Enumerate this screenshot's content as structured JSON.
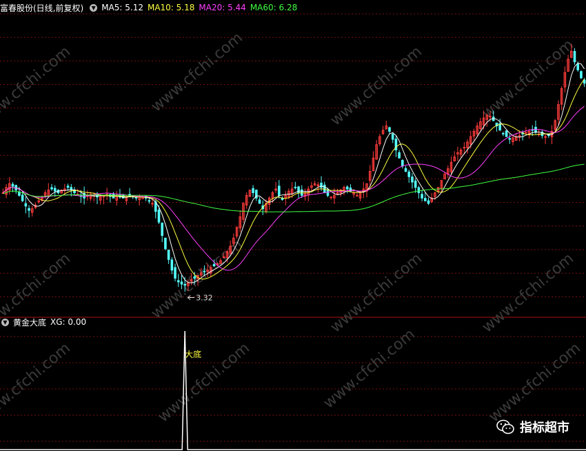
{
  "main_header": {
    "stock": "富春股份(日线,前复权)",
    "ma5": "MA5: 5.12",
    "ma10": "MA10: 5.18",
    "ma20": "MA20: 5.44",
    "ma60": "MA60: 6.28"
  },
  "sub_header": {
    "indicator": "黄金大底",
    "xg": "XG: 0.00"
  },
  "colors": {
    "up": "#ff3c3c",
    "down": "#54ffff",
    "ma5": "#ffffff",
    "ma10": "#ffff40",
    "ma20": "#ff40ff",
    "ma60": "#40ff40",
    "grid": "#7a1010"
  },
  "brand": "指标超市",
  "watermark": "www.cfchi.com",
  "chart_data": [
    {
      "type": "candlestick",
      "title": "富春股份(日线,前复权)",
      "ylim": [
        2.9,
        8.4
      ],
      "grid": true,
      "low_marker": {
        "label": "3.32",
        "value": 3.32
      },
      "closes": [
        5.05,
        5.15,
        5.22,
        5.17,
        5.1,
        5.0,
        4.9,
        4.8,
        4.72,
        4.75,
        4.82,
        4.9,
        4.95,
        5.05,
        5.1,
        5.12,
        5.08,
        5.05,
        5.1,
        5.12,
        5.15,
        5.1,
        5.05,
        5.02,
        4.98,
        4.95,
        5.0,
        5.02,
        5.0,
        4.97,
        4.98,
        5.0,
        5.02,
        4.98,
        4.95,
        4.98,
        4.97,
        4.95,
        4.98,
        4.99,
        4.97,
        4.95,
        4.98,
        4.97,
        4.95,
        4.9,
        4.85,
        4.7,
        4.5,
        4.25,
        4.0,
        3.8,
        3.6,
        3.45,
        3.38,
        3.34,
        3.32,
        3.36,
        3.42,
        3.45,
        3.5,
        3.55,
        3.58,
        3.6,
        3.65,
        3.68,
        3.72,
        3.78,
        3.85,
        3.95,
        4.05,
        4.2,
        4.4,
        4.6,
        4.85,
        5.0,
        5.1,
        5.05,
        4.95,
        4.85,
        4.75,
        4.85,
        4.95,
        5.05,
        5.12,
        5.0,
        4.92,
        5.0,
        5.08,
        5.12,
        5.15,
        5.05,
        5.0,
        5.05,
        5.12,
        5.18,
        5.22,
        5.2,
        5.15,
        5.05,
        5.0,
        4.97,
        5.0,
        5.05,
        5.1,
        5.15,
        5.12,
        5.08,
        5.05,
        5.0,
        5.05,
        5.12,
        5.22,
        5.45,
        5.7,
        5.95,
        6.1,
        6.22,
        6.3,
        6.2,
        6.05,
        5.85,
        5.7,
        5.55,
        5.45,
        5.35,
        5.25,
        5.15,
        5.05,
        4.95,
        4.9,
        4.85,
        4.95,
        5.05,
        5.15,
        5.28,
        5.4,
        5.5,
        5.62,
        5.72,
        5.8,
        5.85,
        5.9,
        6.0,
        6.1,
        6.2,
        6.3,
        6.38,
        6.45,
        6.5,
        6.48,
        6.4,
        6.3,
        6.22,
        6.15,
        6.1,
        6.05,
        6.08,
        6.1,
        6.12,
        6.15,
        6.18,
        6.2,
        6.22,
        6.18,
        6.15,
        6.12,
        6.1,
        6.12,
        6.2,
        6.4,
        6.7,
        7.0,
        7.3,
        7.55,
        7.7,
        7.5,
        7.35,
        7.2,
        7.1
      ],
      "ma_lines": [
        "MA5",
        "MA10",
        "MA20",
        "MA60"
      ]
    },
    {
      "type": "line",
      "title": "黄金大底",
      "series": [
        {
          "name": "XG",
          "spike_index": 56,
          "label": "大底"
        }
      ]
    }
  ]
}
